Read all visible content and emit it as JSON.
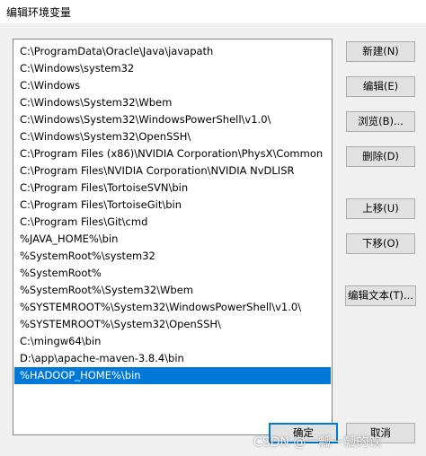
{
  "window": {
    "title": "编辑环境变量"
  },
  "path_list": {
    "items": [
      "C:\\ProgramData\\Oracle\\Java\\javapath",
      "C:\\Windows\\system32",
      "C:\\Windows",
      "C:\\Windows\\System32\\Wbem",
      "C:\\Windows\\System32\\WindowsPowerShell\\v1.0\\",
      "C:\\Windows\\System32\\OpenSSH\\",
      "C:\\Program Files (x86)\\NVIDIA Corporation\\PhysX\\Common",
      "C:\\Program Files\\NVIDIA Corporation\\NVIDIA NvDLISR",
      "C:\\Program Files\\TortoiseSVN\\bin",
      "C:\\Program Files\\TortoiseGit\\bin",
      "C:\\Program Files\\Git\\cmd",
      "%JAVA_HOME%\\bin",
      "%SystemRoot%\\system32",
      "%SystemRoot%",
      "%SystemRoot%\\System32\\Wbem",
      "%SYSTEMROOT%\\System32\\WindowsPowerShell\\v1.0\\",
      "%SYSTEMROOT%\\System32\\OpenSSH\\",
      "C:\\mingw64\\bin",
      "D:\\app\\apache-maven-3.8.4\\bin",
      "%HADOOP_HOME%\\bin"
    ],
    "selected_index": 19
  },
  "buttons": {
    "new": "新建(N)",
    "edit": "编辑(E)",
    "browse": "浏览(B)...",
    "delete": "删除(D)",
    "move_up": "上移(U)",
    "move_down": "下移(O)",
    "edit_text": "编辑文本(T)...",
    "ok": "确定",
    "cancel": "取消"
  },
  "watermark": "CSDN @一瓢一瓢的饮",
  "colors": {
    "selection": "#0078d7",
    "dialog_bg": "#f0f0f0"
  }
}
